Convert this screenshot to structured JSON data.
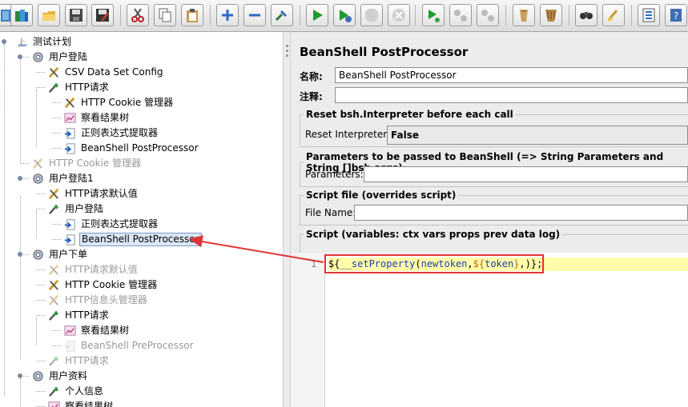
{
  "toolbar": {
    "buttons": [
      {
        "name": "new-plan-icon"
      },
      {
        "name": "templates-icon"
      },
      {
        "name": "open-icon"
      },
      {
        "name": "save-icon"
      },
      {
        "name": "save-as-icon"
      },
      {
        "name": "cut-icon"
      },
      {
        "name": "copy-icon"
      },
      {
        "name": "paste-icon"
      },
      {
        "name": "expand-icon"
      },
      {
        "name": "collapse-icon"
      },
      {
        "name": "toggle-icon"
      },
      {
        "name": "start-icon"
      },
      {
        "name": "start-no-pause-icon"
      },
      {
        "name": "stop-icon"
      },
      {
        "name": "shutdown-icon"
      },
      {
        "name": "remote-start-icon"
      },
      {
        "name": "remote-stop-icon"
      },
      {
        "name": "remote-shutdown-icon"
      },
      {
        "name": "clear-icon"
      },
      {
        "name": "clear-all-icon"
      },
      {
        "name": "search-icon"
      },
      {
        "name": "reset-search-icon"
      },
      {
        "name": "function-helper-icon"
      },
      {
        "name": "help-icon"
      }
    ]
  },
  "tree": {
    "nodes": [
      {
        "label": "测试计划",
        "icon": "test-plan-icon",
        "disabled": false
      },
      {
        "label": "用户登陆",
        "icon": "thread-group-icon",
        "disabled": false
      },
      {
        "label": "CSV Data Set Config",
        "icon": "config-element-icon",
        "disabled": false
      },
      {
        "label": "HTTP请求",
        "icon": "sampler-icon",
        "disabled": false
      },
      {
        "label": "HTTP Cookie 管理器",
        "icon": "config-element-icon",
        "disabled": false
      },
      {
        "label": "察看结果树",
        "icon": "listener-icon",
        "disabled": false
      },
      {
        "label": "正则表达式提取器",
        "icon": "post-processor-icon",
        "disabled": false
      },
      {
        "label": "BeanShell PostProcessor",
        "icon": "post-processor-icon",
        "disabled": false
      },
      {
        "label": "HTTP Cookie 管理器",
        "icon": "config-element-icon",
        "disabled": true
      },
      {
        "label": "用户登陆1",
        "icon": "thread-group-icon",
        "disabled": false
      },
      {
        "label": "HTTP请求默认值",
        "icon": "config-element-icon",
        "disabled": false
      },
      {
        "label": "用户登陆",
        "icon": "sampler-icon",
        "disabled": false
      },
      {
        "label": "正则表达式提取器",
        "icon": "post-processor-icon",
        "disabled": false
      },
      {
        "label": "BeanShell PostProcessor",
        "icon": "post-processor-icon",
        "disabled": false,
        "selected": true
      },
      {
        "label": "用户下单",
        "icon": "thread-group-icon",
        "disabled": false
      },
      {
        "label": "HTTP请求默认值",
        "icon": "config-element-icon",
        "disabled": true
      },
      {
        "label": "HTTP Cookie 管理器",
        "icon": "config-element-icon",
        "disabled": false
      },
      {
        "label": "HTTP信息头管理器",
        "icon": "config-element-icon",
        "disabled": true
      },
      {
        "label": "HTTP请求",
        "icon": "sampler-icon",
        "disabled": false
      },
      {
        "label": "察看结果树",
        "icon": "listener-icon",
        "disabled": false
      },
      {
        "label": "BeanShell PreProcessor",
        "icon": "pre-processor-icon",
        "disabled": true
      },
      {
        "label": "HTTP请求",
        "icon": "sampler-icon",
        "disabled": true
      },
      {
        "label": "用户资料",
        "icon": "thread-group-icon",
        "disabled": false
      },
      {
        "label": "个人信息",
        "icon": "sampler-icon",
        "disabled": false
      },
      {
        "label": "察看结果树",
        "icon": "listener-icon",
        "disabled": false
      }
    ]
  },
  "panel": {
    "title": "BeanShell PostProcessor",
    "name_label": "名称:",
    "name_value": "BeanShell PostProcessor",
    "comments_label": "注释:",
    "comments_value": "",
    "reset_legend": "Reset bsh.Interpreter before each call",
    "reset_label": "Reset Interpreter:",
    "reset_value": "False",
    "params_legend": "Parameters to be passed to BeanShell (=> String Parameters and String []bsh.args)",
    "params_label": "Parameters:",
    "params_value": "",
    "file_legend": "Script file (overrides script)",
    "file_label": "File Name:",
    "file_value": "",
    "script_legend": "Script (variables: ctx vars props prev data log)",
    "script_line_number": "1",
    "script_tokens": [
      {
        "text": "${",
        "cls": "c-punct"
      },
      {
        "text": "__setProperty",
        "cls": "c-fn"
      },
      {
        "text": "(",
        "cls": "c-punct"
      },
      {
        "text": "newtoken",
        "cls": "c-fn"
      },
      {
        "text": ",",
        "cls": "c-punct"
      },
      {
        "text": "${",
        "cls": "c-var"
      },
      {
        "text": "token",
        "cls": "c-fn"
      },
      {
        "text": "}",
        "cls": "c-var"
      },
      {
        "text": ",)",
        "cls": "c-punct"
      },
      {
        "text": "}",
        "cls": "c-punct"
      },
      {
        "text": ";",
        "cls": "c-punct"
      }
    ]
  },
  "colors": {
    "selection_bg": "#dce7f5",
    "highlight_line": "#fffcaa",
    "annotation_red": "#e03434"
  }
}
